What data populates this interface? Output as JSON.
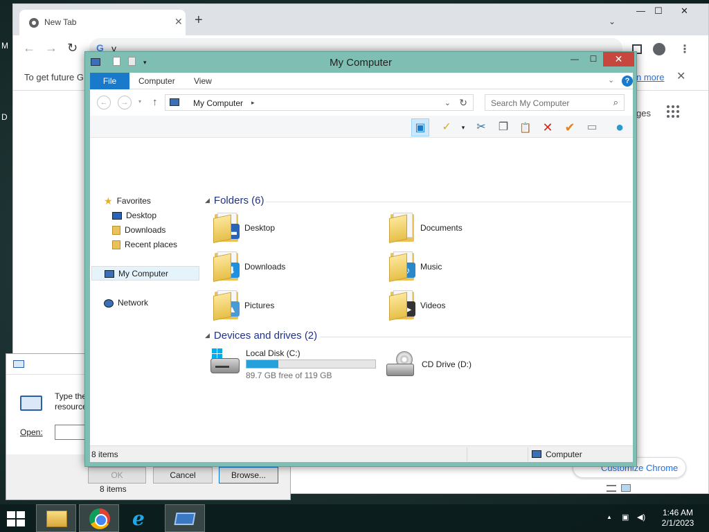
{
  "chrome": {
    "tab_title": "New Tab",
    "tab_close": "✕",
    "new_tab": "+",
    "tab_search": "⌄",
    "win_min": "—",
    "win_max": "☐",
    "win_close": "✕",
    "back": "←",
    "forward": "→",
    "reload": "↻",
    "omnibox_g": "G",
    "omnibox_text": "y",
    "infobar_text": "To get future G",
    "infobar_link": "n more",
    "infobar_close": "✕",
    "ntp_images": "ges",
    "customize": "Customize Chrome"
  },
  "desktop_edge": {
    "m": "M",
    "d": "D"
  },
  "run_dialog": {
    "desc": "Type the resource",
    "open_label": "Open:",
    "ok": "OK",
    "cancel": "Cancel",
    "browse": "Browse..."
  },
  "explorer": {
    "title": "My Computer",
    "minimize": "—",
    "maximize": "☐",
    "close": "✕",
    "ribbon_tabs": {
      "file": "File",
      "computer": "Computer",
      "view": "View"
    },
    "ribbon_chevron": "⌄",
    "help": "?",
    "address": {
      "crumb": "My Computer",
      "arrow": "▸",
      "dropdown": "⌄",
      "refresh": "↻",
      "up": "↑",
      "back": "←",
      "forward": "→"
    },
    "search_placeholder": "Search My Computer",
    "search_icon": "⌕",
    "commands": {
      "pane": "▣",
      "properties": "✓",
      "cut": "✂",
      "copy": "❐",
      "paste": "📋",
      "delete": "✕",
      "rename": "✔",
      "drive": "▭",
      "network": "●"
    },
    "nav": {
      "favorites": "Favorites",
      "desktop": "Desktop",
      "downloads": "Downloads",
      "recent": "Recent places",
      "my_computer": "My Computer",
      "network": "Network"
    },
    "groups": {
      "folders": "Folders (6)",
      "devices": "Devices and drives (2)"
    },
    "folders": [
      {
        "name": "Desktop",
        "badge": "▬",
        "badge_color": "#2a64b8"
      },
      {
        "name": "Documents",
        "badge": "",
        "badge_color": ""
      },
      {
        "name": "Downloads",
        "badge": "⬇",
        "badge_color": "#1e90e0"
      },
      {
        "name": "Music",
        "badge": "♪",
        "badge_color": "#2a88c8"
      },
      {
        "name": "Pictures",
        "badge": "▲",
        "badge_color": "#4a9ad8"
      },
      {
        "name": "Videos",
        "badge": "▶",
        "badge_color": "#333333"
      }
    ],
    "drives": {
      "c_name": "Local Disk (C:)",
      "c_free": "89.7 GB free of 119 GB",
      "c_used_fraction": 0.246,
      "d_name": "CD Drive (D:)"
    },
    "item_count": "8 items",
    "status_count": "8 items",
    "status_location": "Computer"
  },
  "taskbar": {
    "tray_up": "▲",
    "tray_net": "▣",
    "tray_vol": "◀)",
    "time": "1:46 AM",
    "date": "2/1/2023"
  }
}
